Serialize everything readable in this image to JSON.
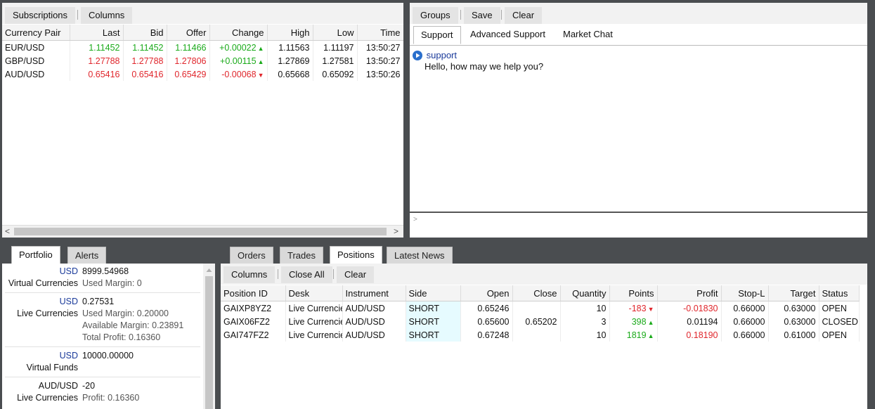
{
  "subscriptions_toolbar": {
    "subscriptions_label": "Subscriptions",
    "columns_label": "Columns"
  },
  "quotes": {
    "headers": [
      "Currency Pair",
      "Last",
      "Bid",
      "Offer",
      "Change",
      "High",
      "Low",
      "Time"
    ],
    "rows": [
      {
        "pair": "EUR/USD",
        "last": "1.11452",
        "bid": "1.11452",
        "offer": "1.11466",
        "change": "+0.00022",
        "high": "1.11563",
        "low": "1.11197",
        "time": "13:50:27",
        "dir": "up",
        "arrow": "▲"
      },
      {
        "pair": "GBP/USD",
        "last": "1.27788",
        "bid": "1.27788",
        "offer": "1.27806",
        "change": "+0.00115",
        "high": "1.27869",
        "low": "1.27581",
        "time": "13:50:27",
        "dir": "down",
        "arrow": "▲"
      },
      {
        "pair": "AUD/USD",
        "last": "0.65416",
        "bid": "0.65416",
        "offer": "0.65429",
        "change": "-0.00068",
        "high": "0.65668",
        "low": "0.65092",
        "time": "13:50:26",
        "dir": "down",
        "arrow": "▼"
      }
    ],
    "scroll_left": "<",
    "scroll_right": ">"
  },
  "chat_toolbar": {
    "groups_label": "Groups",
    "save_label": "Save",
    "clear_label": "Clear"
  },
  "chat_tabs": [
    "Support",
    "Advanced Support",
    "Market Chat"
  ],
  "chat": {
    "sender": "support",
    "message": "Hello, how may we help you?",
    "input_prompt": ">"
  },
  "left_tabs": [
    "Portfolio",
    "Alerts"
  ],
  "portfolio": {
    "entries": [
      {
        "currency": "USD",
        "name": "Virtual Currencies",
        "value": "8999.54968",
        "details": [
          "Used Margin:  0"
        ]
      },
      {
        "currency": "USD",
        "name": "Live Currencies",
        "value": "0.27531",
        "details": [
          "Used Margin:  0.20000",
          "Available Margin:  0.23891",
          "Total Profit:  0.16360"
        ]
      },
      {
        "currency": "USD",
        "name": "Virtual Funds",
        "value": "10000.00000",
        "details": []
      },
      {
        "currency": "AUD/USD",
        "name": "Live Currencies",
        "value": "-20",
        "details": [
          "Profit:  0.16360"
        ]
      }
    ]
  },
  "right_tabs": [
    "Orders",
    "Trades",
    "Positions",
    "Latest News"
  ],
  "positions_toolbar": {
    "columns_label": "Columns",
    "close_all_label": "Close All",
    "clear_label": "Clear"
  },
  "positions": {
    "headers": [
      "Position ID",
      "Desk",
      "Instrument",
      "Side",
      "Open",
      "Close",
      "Quantity",
      "Points",
      "Profit",
      "Stop-L",
      "Target",
      "Status"
    ],
    "rows": [
      {
        "id": "GAIXP8YZ2",
        "desk": "Live Currencies",
        "instrument": "AUD/USD",
        "side": "SHORT",
        "open": "0.65246",
        "close": "",
        "quantity": "10",
        "points": "-183",
        "points_dir": "down",
        "points_arrow": "▼",
        "profit": "-0.01830",
        "profit_dir": "down",
        "stop": "0.66000",
        "target": "0.63000",
        "status": "OPEN"
      },
      {
        "id": "GAIX06FZ2",
        "desk": "Live Currencies",
        "instrument": "AUD/USD",
        "side": "SHORT",
        "open": "0.65600",
        "close": "0.65202",
        "quantity": "3",
        "points": "398",
        "points_dir": "up",
        "points_arrow": "▲",
        "profit": "0.01194",
        "profit_dir": "neutral",
        "stop": "0.66000",
        "target": "0.63000",
        "status": "CLOSED"
      },
      {
        "id": "GAI747FZ2",
        "desk": "Live Currencies",
        "instrument": "AUD/USD",
        "side": "SHORT",
        "open": "0.67248",
        "close": "",
        "quantity": "10",
        "points": "1819",
        "points_dir": "up",
        "points_arrow": "▲",
        "profit": "0.18190",
        "profit_dir": "down",
        "stop": "0.66000",
        "target": "0.61000",
        "status": "OPEN"
      }
    ]
  },
  "colors": {
    "up": "#1aaa1a",
    "down": "#e0262c",
    "side_bg": "#e6fbff",
    "accent_blue": "#1a3a9a"
  }
}
